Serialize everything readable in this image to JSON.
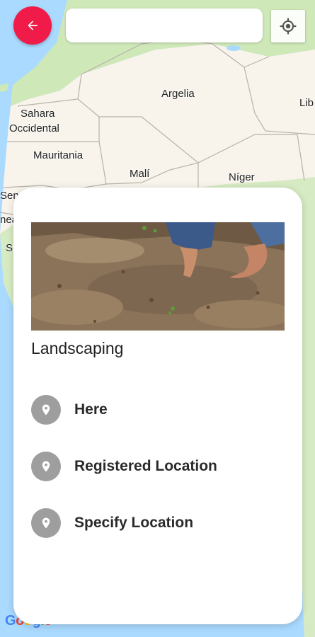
{
  "map": {
    "labels": {
      "argelia": "Argelia",
      "lib": "Lib",
      "sahara_line1": "Sahara",
      "sahara_line2": "Occidental",
      "mauritania": "Mauritania",
      "mali": "Malí",
      "niger": "Níger",
      "sene": "Sene",
      "nea": "nea",
      "s": "S"
    },
    "attribution": "Google"
  },
  "toolbar": {
    "back_icon": "arrow-left-icon",
    "search_value": "",
    "search_placeholder": "",
    "locate_icon": "my-location-icon"
  },
  "sheet": {
    "image_subject": "hands planting in soil",
    "title": "Landscaping",
    "options": [
      {
        "label": "Here",
        "icon": "location-pin-icon"
      },
      {
        "label": "Registered Location",
        "icon": "location-pin-icon"
      },
      {
        "label": "Specify Location",
        "icon": "location-pin-icon"
      }
    ]
  },
  "colors": {
    "accent": "#f01b48",
    "water": "#aadaff",
    "land": "#f8f4ec",
    "green_land": "#cfe8b8",
    "icon_gray": "#9e9e9e"
  }
}
